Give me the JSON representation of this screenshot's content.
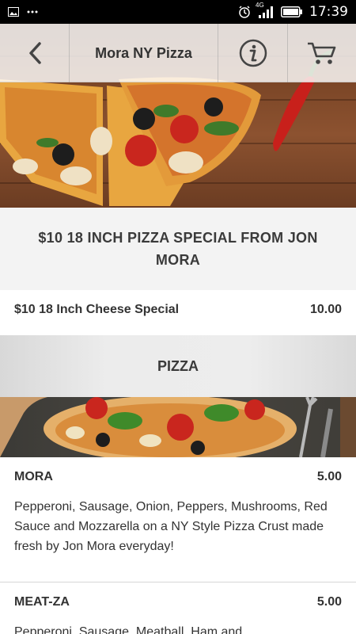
{
  "status_bar": {
    "time": "17:39",
    "network": "4G",
    "icons": [
      "image-icon",
      "more-dots-icon",
      "alarm-icon",
      "signal-icon",
      "battery-icon"
    ]
  },
  "header": {
    "title": "Mora NY Pizza",
    "icons": [
      "back-arrow-icon",
      "info-icon",
      "cart-icon"
    ]
  },
  "sections": {
    "special": {
      "heading": "$10 18 INCH PIZZA SPECIAL FROM JON MORA",
      "items": [
        {
          "name": "$10 18 Inch Cheese Special",
          "price": "10.00"
        }
      ]
    },
    "pizza": {
      "heading": "PIZZA",
      "items": [
        {
          "name": "MORA",
          "price": "5.00",
          "description": "Pepperoni, Sausage, Onion, Peppers, Mushrooms, Red Sauce and Mozzarella on a NY Style Pizza Crust made fresh by Jon Mora everyday!"
        },
        {
          "name": "MEAT-ZA",
          "price": "5.00",
          "description": "Pepperoni, Sausage, Meatball, Ham and"
        }
      ]
    }
  },
  "colors": {
    "status_bar_bg": "#000000",
    "heading_text": "#3a3a3a",
    "section_bg": "#f3f3f3"
  }
}
